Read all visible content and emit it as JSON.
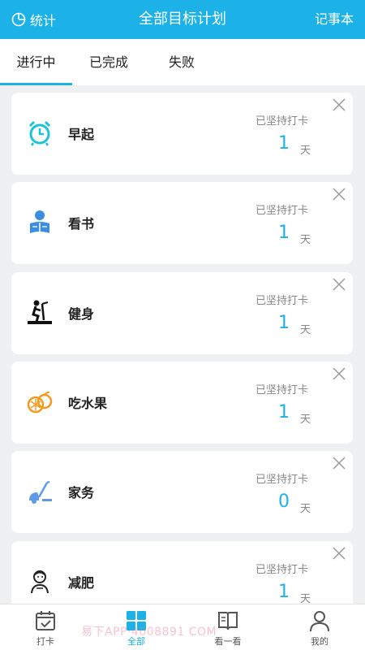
{
  "header": {
    "left_label": "统计",
    "title": "全部目标计划",
    "right_label": "记事本"
  },
  "tabs": [
    {
      "label": "进行中"
    },
    {
      "label": "已完成"
    },
    {
      "label": "失败"
    }
  ],
  "goals": [
    {
      "name": "早起",
      "streak_label": "已坚持打卡",
      "days": "1",
      "unit": "天",
      "icon": "alarm-clock-icon"
    },
    {
      "name": "看书",
      "streak_label": "已坚持打卡",
      "days": "1",
      "unit": "天",
      "icon": "reader-icon"
    },
    {
      "name": "健身",
      "streak_label": "已坚持打卡",
      "days": "1",
      "unit": "天",
      "icon": "treadmill-icon"
    },
    {
      "name": "吃水果",
      "streak_label": "已坚持打卡",
      "days": "1",
      "unit": "天",
      "icon": "fruit-icon"
    },
    {
      "name": "家务",
      "streak_label": "已坚持打卡",
      "days": "0",
      "unit": "天",
      "icon": "vacuum-icon"
    },
    {
      "name": "减肥",
      "streak_label": "已坚持打卡",
      "days": "1",
      "unit": "天",
      "icon": "person-icon"
    }
  ],
  "bottom_nav": [
    {
      "label": "打卡"
    },
    {
      "label": "全部"
    },
    {
      "label": "看一看"
    },
    {
      "label": "我的"
    }
  ],
  "watermark": "易下APP·4008891 COM",
  "colors": {
    "accent": "#1cb2e8",
    "card_bg": "#ffffff",
    "page_bg": "#eef0f2"
  }
}
